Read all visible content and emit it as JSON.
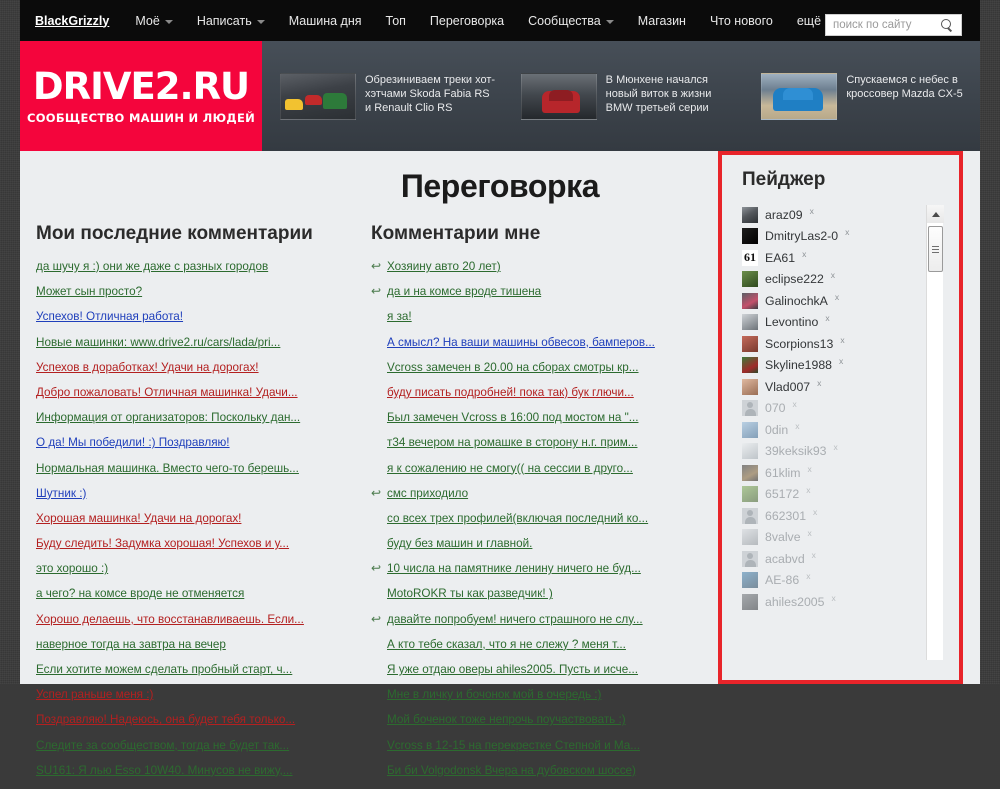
{
  "nav": {
    "user": "BlackGrizzly",
    "items": [
      {
        "label": "Моё",
        "caret": true
      },
      {
        "label": "Написать",
        "caret": true
      },
      {
        "label": "Машина дня",
        "caret": false
      },
      {
        "label": "Топ",
        "caret": false
      },
      {
        "label": "Переговорка",
        "caret": false
      },
      {
        "label": "Сообщества",
        "caret": true
      },
      {
        "label": "Магазин",
        "caret": false
      },
      {
        "label": "Что нового",
        "caret": false
      },
      {
        "label": "ещё",
        "caret": true
      }
    ],
    "search_placeholder": "поиск по сайту",
    "search_value": "",
    "search_icon": "search-icon"
  },
  "logo": {
    "main": "DRIVE2.RU",
    "sub": "СООБЩЕСТВО МАШИН И ЛЮДЕЙ",
    "bg": "#f4053c"
  },
  "promos": [
    {
      "title": "Обрезиниваем треки хот-хэтчами Skoda Fabia RS и Renault Clio RS"
    },
    {
      "title": "В Мюнхене начался новый виток в жизни BMW третьей серии"
    },
    {
      "title": "Спускаемся с небес в кроссовер Mazda CX-5"
    }
  ],
  "page_title": "Переговорка",
  "left_column": {
    "heading": "Мои последние комментарии",
    "items": [
      {
        "text": "да шучу я :) они же даже с разных городов",
        "color": "green"
      },
      {
        "text": "Может сын просто?",
        "color": "green"
      },
      {
        "text": "Успехов! Отличная работа!",
        "color": "blue"
      },
      {
        "text": "Новые машинки: www.drive2.ru/cars/lada/pri...",
        "color": "green"
      },
      {
        "text": "Успехов в доработках! Удачи на дорогах!",
        "color": "red"
      },
      {
        "text": "Добро пожаловать! Отличная машинка! Удачи...",
        "color": "red"
      },
      {
        "text": "Информация от организаторов: Поскольку дан...",
        "color": "green"
      },
      {
        "text": "О да! Мы победили! :) Поздравляю!",
        "color": "blue"
      },
      {
        "text": "Нормальная машинка. Вместо чего-то берешь...",
        "color": "green"
      },
      {
        "text": "Шутник :)",
        "color": "blue"
      },
      {
        "text": "Хорошая машинка! Удачи на дорогах!",
        "color": "red"
      },
      {
        "text": "Буду следить! Задумка хорошая! Успехов и у...",
        "color": "red"
      },
      {
        "text": "это хорошо :)",
        "color": "green"
      },
      {
        "text": "а чего? на комсе вроде не отменяется",
        "color": "green"
      },
      {
        "text": "Хорошо делаешь, что восстанавливаешь. Если...",
        "color": "red"
      },
      {
        "text": "наверное тогда на завтра на вечер",
        "color": "green"
      },
      {
        "text": "Если хотите можем сделать пробный старт, ч...",
        "color": "green"
      },
      {
        "text": "Успел раньше меня :)",
        "color": "red"
      },
      {
        "text": "Поздравляю! Надеюсь, она будет тебя только...",
        "color": "red"
      },
      {
        "text": "Следите за сообществом, тогда не будет так...",
        "color": "green"
      },
      {
        "text": "SU161: Я лью Esso 10W40. Минусов не вижу,...",
        "color": "green"
      }
    ]
  },
  "mid_column": {
    "heading": "Комментарии мне",
    "items": [
      {
        "text": "Хозяину авто 20 лет)",
        "color": "green",
        "reply": true
      },
      {
        "text": "да и на комсе вроде тишена",
        "color": "green",
        "reply": true
      },
      {
        "text": "я за!",
        "color": "green",
        "reply": false
      },
      {
        "text": "А смысл? На ваши машины обвесов, бамперов...",
        "color": "blue",
        "reply": false
      },
      {
        "text": "Vcross замечен в 20.00 на сборах смотры кр...",
        "color": "green",
        "reply": false
      },
      {
        "text": "буду писать подробней! пока так) бук глючи...",
        "color": "red",
        "reply": false
      },
      {
        "text": "Был замечен Vcross в 16:00 под мостом на \"...",
        "color": "green",
        "reply": false
      },
      {
        "text": "т34 вечером на ромашке в сторону н.г. прим...",
        "color": "green",
        "reply": false
      },
      {
        "text": "я к сожалению не смогу(( на сессии в друго...",
        "color": "green",
        "reply": false
      },
      {
        "text": "смс приходило",
        "color": "green",
        "reply": true
      },
      {
        "text": "со всех трех профилей(включая последний ко...",
        "color": "green",
        "reply": false
      },
      {
        "text": "буду без машин и главной.",
        "color": "green",
        "reply": false
      },
      {
        "text": "10 числа на памятнике ленину ничего не буд...",
        "color": "green",
        "reply": true
      },
      {
        "text": "MotoROKR ты как разведчик! )",
        "color": "green",
        "reply": false
      },
      {
        "text": "давайте попробуем! ничего страшного не слу...",
        "color": "green",
        "reply": true
      },
      {
        "text": "А кто тебе сказал, что я не слежу ? меня т...",
        "color": "green",
        "reply": false
      },
      {
        "text": "Я уже отдаю оверы ahiles2005. Пусть и исче...",
        "color": "green",
        "reply": false
      },
      {
        "text": "Мне в личку и бочонок мой в очередь :)",
        "color": "green",
        "reply": false
      },
      {
        "text": "Мой боченок тоже непрочь поучаствовать :)",
        "color": "green",
        "reply": false
      },
      {
        "text": "Vcross в 12-15 на перекрестке Степной и Ма...",
        "color": "green",
        "reply": false
      },
      {
        "text": "Би би Volgodonsk Вчера на дубовском шоссе)",
        "color": "green",
        "reply": false
      }
    ]
  },
  "pager": {
    "title": "Пейджер",
    "remove_label": "x",
    "highlight_color": "#e8242a",
    "users": [
      {
        "name": "araz09",
        "online": true,
        "avatar": "photo-car"
      },
      {
        "name": "DmitryLas2-0",
        "online": true,
        "avatar": "photo-dark"
      },
      {
        "name": "EA61",
        "online": true,
        "avatar": "text-61"
      },
      {
        "name": "eclipse222",
        "online": true,
        "avatar": "photo-green"
      },
      {
        "name": "GalinochkA",
        "online": true,
        "avatar": "photo-pink"
      },
      {
        "name": "Levontino",
        "online": true,
        "avatar": "photo-grey"
      },
      {
        "name": "Scorpions13",
        "online": true,
        "avatar": "photo-red"
      },
      {
        "name": "Skyline1988",
        "online": true,
        "avatar": "photo-green2"
      },
      {
        "name": "Vlad007",
        "online": true,
        "avatar": "photo-face"
      },
      {
        "name": "070",
        "online": false,
        "avatar": "person"
      },
      {
        "name": "0din",
        "online": false,
        "avatar": "photo-blue"
      },
      {
        "name": "39keksik93",
        "online": false,
        "avatar": "photo-white"
      },
      {
        "name": "61klim",
        "online": false,
        "avatar": "photo-dark2"
      },
      {
        "name": "65172",
        "online": false,
        "avatar": "photo-green3"
      },
      {
        "name": "662301",
        "online": false,
        "avatar": "person"
      },
      {
        "name": "8valve",
        "online": false,
        "avatar": "photo-grey2"
      },
      {
        "name": "acabvd",
        "online": false,
        "avatar": "person"
      },
      {
        "name": "AE-86",
        "online": false,
        "avatar": "photo-blue2"
      },
      {
        "name": "ahiles2005",
        "online": false,
        "avatar": "photo-dark3"
      }
    ],
    "scrollbar": {
      "up_icon": "chevron-up-icon",
      "thumb": "scroll-thumb"
    }
  }
}
